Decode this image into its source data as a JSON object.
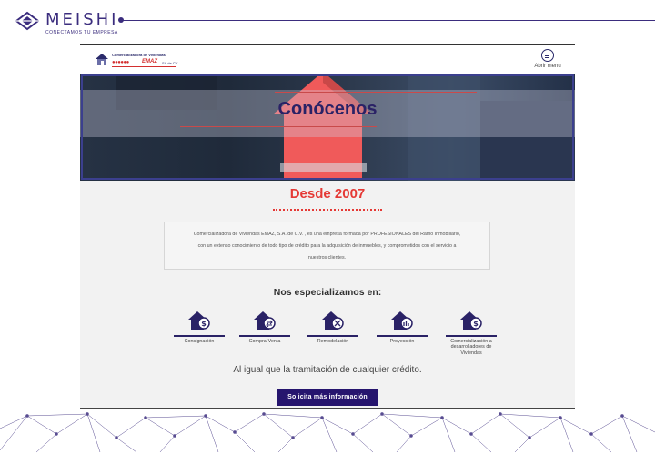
{
  "brand": {
    "name": "MEISHI",
    "tagline": "CONECTAMOS TU EMPRESA",
    "color": "#3b2d7e"
  },
  "site": {
    "logo": {
      "company": "Comercializadora de Viviendas",
      "dots": "●●●●●●",
      "mark": "EMAZ",
      "suffix": "SA de CV"
    },
    "menu": {
      "icon": "hamburger-circle-icon",
      "label": "Abrir menu"
    },
    "hero": {
      "title": "Conócenos"
    },
    "since": "Desde 2007",
    "about": {
      "lines": [
        "Comercializadora de Viviendas EMAZ, S.A. de C.V. , es una empresa formada por PROFESIONALES del Ramo Inmobiliario,",
        "con un extenso conocimiento de todo tipo de crédito para la adquisición de inmuebles, y comprometidos con el servicio a",
        "nuestros clientes."
      ]
    },
    "specialties_title": "Nos especializamos en:",
    "services": [
      {
        "label": "Consignación",
        "icon": "house-money-icon"
      },
      {
        "label": "Compra-Venta",
        "icon": "house-exchange-icon"
      },
      {
        "label": "Remodelación",
        "icon": "house-tools-icon"
      },
      {
        "label": "Proyección",
        "icon": "house-plan-icon"
      },
      {
        "label": "Comercialización a desarrolladores de Viviendas",
        "icon": "house-dollar-icon"
      }
    ],
    "credit_text": "Al igual que la tramitación de cualquier crédito.",
    "cta_label": "Solicita más información",
    "colors": {
      "accent_red": "#e53935",
      "navy": "#26156e",
      "background": "#f2f2f2"
    }
  }
}
